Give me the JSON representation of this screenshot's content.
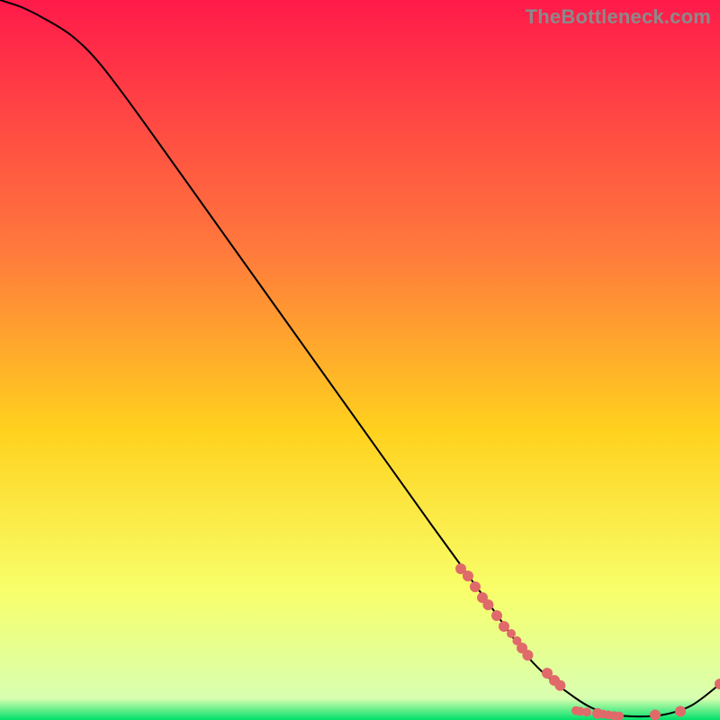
{
  "watermark": "TheBottleneck.com",
  "chart_data": {
    "type": "line",
    "title": "",
    "xlabel": "",
    "ylabel": "",
    "xlim": [
      0,
      100
    ],
    "ylim": [
      0,
      100
    ],
    "grid": false,
    "legend": false,
    "background_gradient_top": "#ff1a4a",
    "background_gradient_mid_upper": "#ff7a3c",
    "background_gradient_mid": "#ffd21e",
    "background_gradient_lower": "#f8ff6a",
    "background_gradient_bottom": "#00e06a",
    "series": [
      {
        "name": "bottleneck-curve",
        "color": "#000000",
        "x": [
          0,
          3,
          6,
          10,
          14,
          20,
          30,
          40,
          50,
          60,
          68,
          74,
          80,
          84,
          88,
          92,
          96,
          100
        ],
        "y": [
          100,
          99,
          97.5,
          95,
          91,
          83,
          69,
          55,
          41,
          27,
          16,
          8,
          3,
          1,
          0.5,
          0.7,
          2,
          5
        ]
      }
    ],
    "markers": {
      "color": "#e06a6a",
      "radius_primary": 6,
      "radius_secondary": 5,
      "points": [
        {
          "x": 64,
          "y": 21,
          "r": 6
        },
        {
          "x": 65,
          "y": 20,
          "r": 6
        },
        {
          "x": 66,
          "y": 18.5,
          "r": 6
        },
        {
          "x": 67,
          "y": 17,
          "r": 6
        },
        {
          "x": 67.8,
          "y": 16,
          "r": 6
        },
        {
          "x": 69,
          "y": 14.5,
          "r": 6
        },
        {
          "x": 70,
          "y": 13,
          "r": 6
        },
        {
          "x": 71,
          "y": 12,
          "r": 5
        },
        {
          "x": 71.8,
          "y": 11,
          "r": 5
        },
        {
          "x": 72.5,
          "y": 10,
          "r": 6
        },
        {
          "x": 73.3,
          "y": 9,
          "r": 6
        },
        {
          "x": 76,
          "y": 6.5,
          "r": 6
        },
        {
          "x": 77,
          "y": 5.5,
          "r": 6
        },
        {
          "x": 77.8,
          "y": 4.8,
          "r": 6
        },
        {
          "x": 80,
          "y": 1.3,
          "r": 5
        },
        {
          "x": 80.6,
          "y": 1.2,
          "r": 5
        },
        {
          "x": 81.5,
          "y": 1.1,
          "r": 5
        },
        {
          "x": 83,
          "y": 0.9,
          "r": 6
        },
        {
          "x": 83.8,
          "y": 0.8,
          "r": 5
        },
        {
          "x": 84.5,
          "y": 0.7,
          "r": 5
        },
        {
          "x": 85.3,
          "y": 0.6,
          "r": 5
        },
        {
          "x": 86,
          "y": 0.55,
          "r": 5
        },
        {
          "x": 91,
          "y": 0.7,
          "r": 6
        },
        {
          "x": 94.5,
          "y": 1.2,
          "r": 6
        },
        {
          "x": 100,
          "y": 5,
          "r": 6
        }
      ]
    }
  }
}
